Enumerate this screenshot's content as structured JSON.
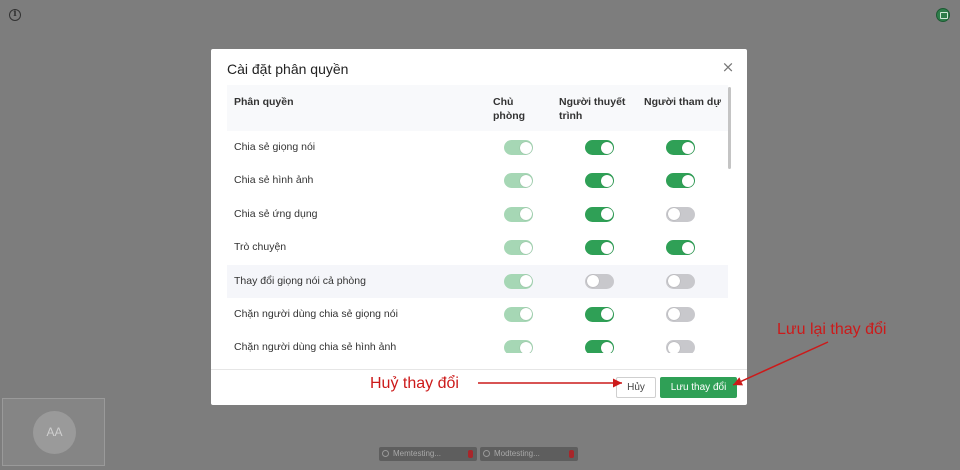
{
  "modal": {
    "title": "Cài đặt phân quyền",
    "close_symbol": "×",
    "columns": {
      "name": "Phân quyền",
      "owner": "Chủ phòng",
      "presenter": "Người thuyết trình",
      "attendee": "Người tham dự"
    },
    "rows": [
      {
        "label": "Chia sẻ giọng nói",
        "owner": "on-disabled",
        "presenter": "on",
        "attendee": "on"
      },
      {
        "label": "Chia sẻ hình ảnh",
        "owner": "on-disabled",
        "presenter": "on",
        "attendee": "on"
      },
      {
        "label": "Chia sẻ ứng dụng",
        "owner": "on-disabled",
        "presenter": "on",
        "attendee": "off"
      },
      {
        "label": "Trò chuyện",
        "owner": "on-disabled",
        "presenter": "on",
        "attendee": "on"
      },
      {
        "label": "Thay đổi giọng nói cả phòng",
        "owner": "on-disabled",
        "presenter": "off",
        "attendee": "off"
      },
      {
        "label": "Chặn người dùng chia sẻ giọng nói",
        "owner": "on-disabled",
        "presenter": "on",
        "attendee": "off"
      },
      {
        "label": "Chặn người dùng chia sẻ hình ảnh",
        "owner": "on-disabled",
        "presenter": "on",
        "attendee": "off"
      }
    ],
    "cancel_label": "Hủy",
    "save_label": "Lưu thay đổi"
  },
  "annotations": {
    "cancel_note": "Huỷ thay đổi",
    "save_note": "Lưu lại thay đổi",
    "color": "#cc1a1a"
  },
  "background": {
    "video_tile_initials": "AA",
    "participants": [
      {
        "name": "Memtesting..."
      },
      {
        "name": "Modtesting..."
      }
    ]
  },
  "colors": {
    "toggle_on": "#2fa056",
    "toggle_disabled_on": "#a6d7b5",
    "toggle_off": "#c8c8cc",
    "overlay": "#7d7d7d"
  },
  "icons": {
    "info": "info-icon",
    "avatar": "user-avatar-icon",
    "close": "close-icon",
    "mic": "microphone-icon",
    "mute": "mic-muted-icon"
  }
}
